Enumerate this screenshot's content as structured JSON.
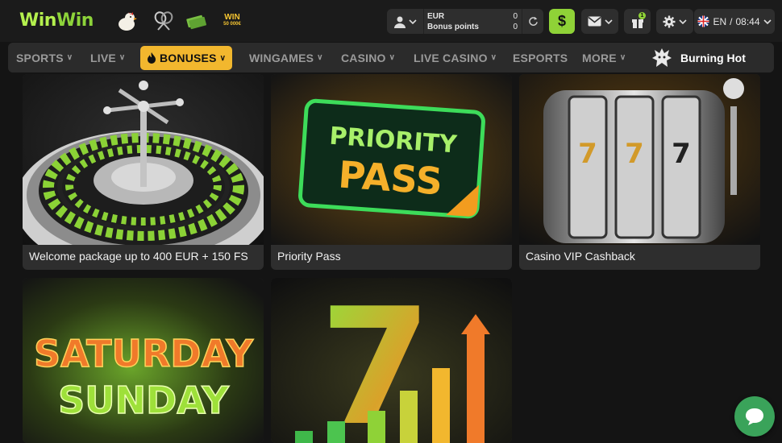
{
  "header": {
    "logo_left": "Win",
    "logo_right": "Win",
    "promo_win_line1": "WIN",
    "promo_win_line2": "50 000€",
    "account": {
      "currency": "EUR",
      "bonus_label": "Bonus points",
      "balance": "0",
      "bonus_points": "0"
    },
    "deposit_symbol": "$",
    "gift_badge": "1",
    "language": "EN",
    "separator": "/",
    "time": "08:44"
  },
  "nav": {
    "items": [
      {
        "label": "SPORTS",
        "has_menu": true
      },
      {
        "label": "LIVE",
        "has_menu": true
      },
      {
        "label": "BONUSES",
        "has_menu": true,
        "active": true
      },
      {
        "label": "WINGAMES",
        "has_menu": true
      },
      {
        "label": "CASINO",
        "has_menu": true
      },
      {
        "label": "LIVE CASINO",
        "has_menu": true
      },
      {
        "label": "ESPORTS",
        "has_menu": false
      },
      {
        "label": "MORE",
        "has_menu": true
      }
    ],
    "featured": "Burning Hot"
  },
  "cards": [
    {
      "title": "Welcome package up to 400 EUR + 150 FS"
    },
    {
      "title": "Priority Pass",
      "art_line1": "PRIORITY",
      "art_line2": "PASS"
    },
    {
      "title": "Casino VIP Cashback",
      "art_reels": [
        "7",
        "7",
        "7"
      ]
    },
    {
      "title": "",
      "art_line1": "SATURDAY",
      "art_line2": "SUNDAY"
    },
    {
      "title": "",
      "art_number": "7"
    }
  ],
  "colors": {
    "accent_green": "#8fd237",
    "accent_yellow": "#f2b72e",
    "chat_green": "#3aa35a"
  },
  "icons": [
    "user-icon",
    "refresh-icon",
    "dollar-icon",
    "mail-icon",
    "gift-icon",
    "gear-icon",
    "uk-flag-icon",
    "chevron-down-icon",
    "fire-icon",
    "dragon-icon",
    "chat-icon"
  ]
}
